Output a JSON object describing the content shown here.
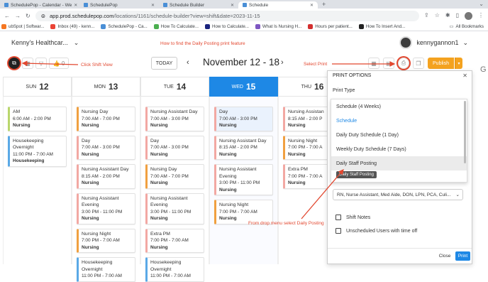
{
  "browser": {
    "tabs": [
      {
        "label": "SchedulePop - Calendar - We"
      },
      {
        "label": "SchedulePop"
      },
      {
        "label": "Schedule Builder"
      },
      {
        "label": "Schedule"
      }
    ],
    "new_tab": "+",
    "url_host": "app.prod.schedulepop.com",
    "url_path": "/locations/1161/schedule-builder?view=shift&date=2023-11-15",
    "bookmarks": [
      {
        "label": "ubSpot | Softwar...",
        "color": "#f57722"
      },
      {
        "label": "Inbox (49) - kenn...",
        "color": "#ea4335"
      },
      {
        "label": "SchedulePop - Ca...",
        "color": "#4a8fd6"
      },
      {
        "label": "How To Calculate...",
        "color": "#4caf50"
      },
      {
        "label": "How to Calculate...",
        "color": "#1a237e"
      },
      {
        "label": "What Is Nursing H...",
        "color": "#7e57c2"
      },
      {
        "label": "Hours per patient...",
        "color": "#d32f2f"
      },
      {
        "label": "How To Insert And...",
        "color": "#222222"
      }
    ],
    "all_bookmarks": "All Bookmarks"
  },
  "header": {
    "org_name": "Kenny's Healthcar...",
    "annotation_top": "How to find the Daily Posting print feature",
    "username": "kennygannon1"
  },
  "toolbar": {
    "today": "TODAY",
    "date_range": "November 12 - 18",
    "publish": "Publish",
    "like_count": "0",
    "annotation_click": "Click Shift View",
    "annotation_print": "Select Print"
  },
  "days": [
    {
      "name": "SUN",
      "date": "12"
    },
    {
      "name": "MON",
      "date": "13"
    },
    {
      "name": "TUE",
      "date": "14"
    },
    {
      "name": "WED",
      "date": "15"
    },
    {
      "name": "THU",
      "date": "16"
    }
  ],
  "columns": [
    [
      {
        "name": "AM",
        "time": "6:00 AM - 2:00 PM",
        "role": "Nursing",
        "color": "green"
      },
      {
        "name": "Housekeeping Overnight",
        "time": "11:00 PM - 7:00 AM",
        "role": "Housekeeping",
        "color": "blue"
      }
    ],
    [
      {
        "name": "Nursing Day",
        "time": "7:00 AM - 7:00 PM",
        "role": "Nursing",
        "color": "orange"
      },
      {
        "name": "Day",
        "time": "7:00 AM - 3:00 PM",
        "role": "Nursing",
        "color": "pink"
      },
      {
        "name": "Nursing Assistant Day",
        "time": "8:15 AM - 2:00 PM",
        "role": "Nursing",
        "color": "pink"
      },
      {
        "name": "Nursing Assistant Evening",
        "time": "3:00 PM - 11:00 PM",
        "role": "Nursing",
        "color": "pink"
      },
      {
        "name": "Nursing Night",
        "time": "7:00 PM - 7:00 AM",
        "role": "Nursing",
        "color": "orange"
      },
      {
        "name": "Housekeeping Overnight",
        "time": "11:00 PM - 7:00 AM",
        "role": "",
        "color": "blue"
      }
    ],
    [
      {
        "name": "Nursing Assistant Day",
        "time": "7:00 AM - 3:00 PM",
        "role": "Nursing",
        "color": "pink"
      },
      {
        "name": "Day",
        "time": "7:00 AM - 3:00 PM",
        "role": "Nursing",
        "color": "pink"
      },
      {
        "name": "Nursing Day",
        "time": "7:00 AM - 7:00 PM",
        "role": "Nursing",
        "color": "orange"
      },
      {
        "name": "Nursing Assistant Evening",
        "time": "3:00 PM - 11:00 PM",
        "role": "Nursing",
        "color": "pink"
      },
      {
        "name": "Extra PM",
        "time": "7:00 PM - 7:00 AM",
        "role": "Nursing",
        "color": "pink"
      },
      {
        "name": "Housekeeping Overnight",
        "time": "11:00 PM - 7:00 AM",
        "role": "",
        "color": "blue"
      }
    ],
    [
      {
        "name": "Day",
        "time": "7:00 AM - 3:00 PM",
        "role": "Nursing",
        "color": "pink",
        "hl": true
      },
      {
        "name": "Nursing Assistant Day",
        "time": "8:15 AM - 2:00 PM",
        "role": "Nursing",
        "color": "pink"
      },
      {
        "name": "Nursing Assistant Evening",
        "time": "3:00 PM - 11:00 PM",
        "role": "Nursing",
        "color": "pink"
      },
      {
        "name": "Nursing Night",
        "time": "7:00 PM - 7:00 AM",
        "role": "Nursing",
        "color": "orange"
      }
    ],
    [
      {
        "name": "Nursing Assistan",
        "time": "8:15 AM - 2:00 P",
        "role": "Nursing",
        "color": "pink"
      },
      {
        "name": "Nursing Night",
        "time": "7:00 PM - 7:00 A",
        "role": "Nursing",
        "color": "orange"
      },
      {
        "name": "Extra PM",
        "time": "7:00 PM - 7:00 A",
        "role": "Nursing",
        "color": "pink"
      }
    ]
  ],
  "print_panel": {
    "title": "PRINT OPTIONS",
    "label": "Print Type",
    "options": [
      {
        "label": "Schedule (4 Weeks)"
      },
      {
        "label": "Schedule"
      },
      {
        "label": "Daily Duty Schedule (1 Day)"
      },
      {
        "label": "Weekly Duty Schedule (7 Days)"
      },
      {
        "label": "Daily Staff Posting"
      }
    ],
    "tooltip": "Daily Staff Posting",
    "roles": "RN, Nurse Assistant, Med Aide, DON, LPN, PCA, Culi...",
    "shift_notes": "Shift Notes",
    "unscheduled": "Unscheduled Users with time off",
    "close": "Close",
    "print": "Print",
    "annotation_drop": "From drop menu select Daily Posting"
  },
  "colors": {
    "accent": "#1e88e5",
    "publish": "#f4a21f",
    "annotation": "#e2472f"
  }
}
